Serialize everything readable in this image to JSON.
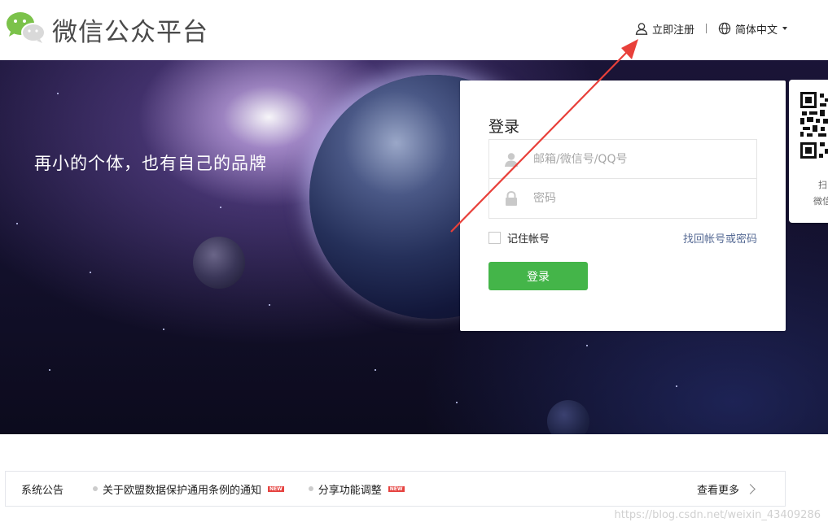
{
  "header": {
    "site_title": "微信公众平台",
    "register_link": "立即注册",
    "language_selector": "简体中文"
  },
  "banner": {
    "slogan": "再小的个体，也有自己的品牌"
  },
  "login": {
    "title": "登录",
    "account_placeholder": "邮箱/微信号/QQ号",
    "password_placeholder": "密码",
    "remember_label": "记住帐号",
    "forgot_link": "找回帐号或密码",
    "submit_label": "登录"
  },
  "qr_panel": {
    "tip_line1": "扫",
    "tip_line2": "微信"
  },
  "notice": {
    "label": "系统公告",
    "items": [
      {
        "title": "关于欧盟数据保护通用条例的通知",
        "badge": "NEW"
      },
      {
        "title": "分享功能调整",
        "badge": "NEW"
      }
    ],
    "more_label": "查看更多"
  },
  "watermark": "https://blog.csdn.net/weixin_43409286",
  "colors": {
    "primary_green": "#44b549",
    "link_blue": "#576b95",
    "new_badge_red": "#e64340",
    "annotation_arrow": "#e8403a"
  },
  "icons": {
    "logo": "wechat-logo-icon",
    "register": "user-icon",
    "language": "globe-icon",
    "account_field": "user-icon",
    "password_field": "lock-icon",
    "more": "chevron-right-icon"
  }
}
